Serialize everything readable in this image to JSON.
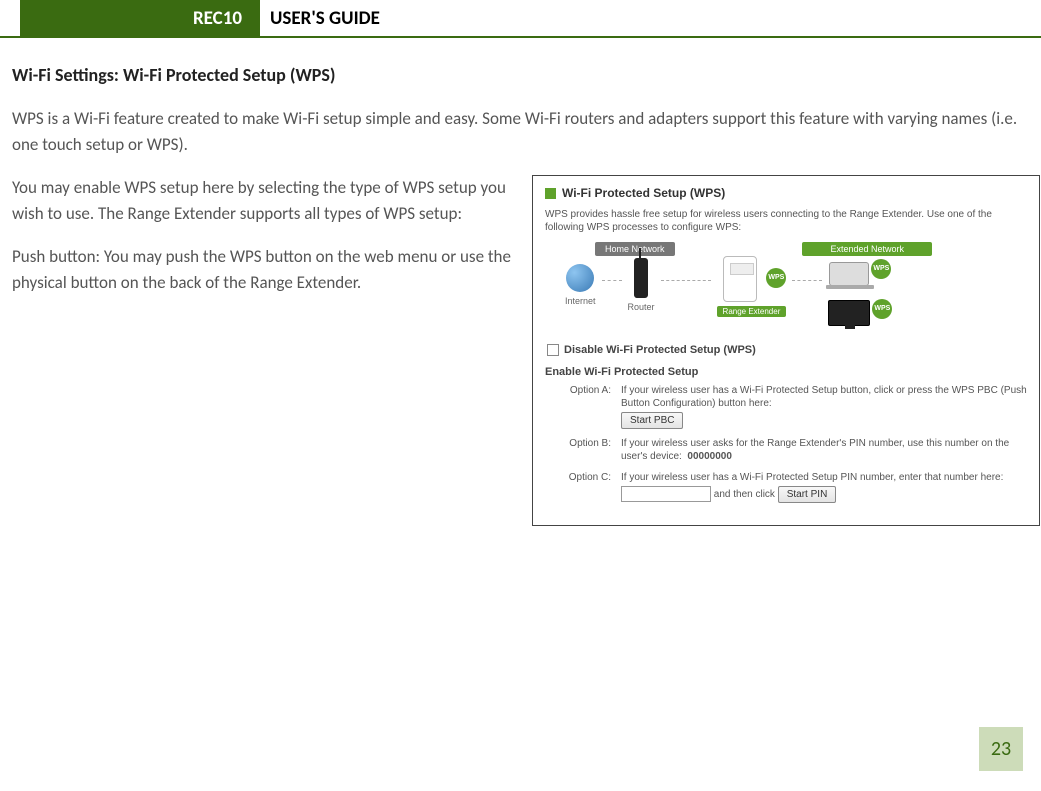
{
  "header": {
    "product": "REC10",
    "title": "USER'S GUIDE"
  },
  "section_title": "Wi-Fi Settings: Wi-Fi Protected Setup (WPS)",
  "para1": "WPS is a Wi-Fi feature created to make Wi-Fi setup simple and easy.  Some Wi-Fi routers and adapters support this feature with varying names (i.e. one touch setup or WPS).",
  "para2": "You may enable WPS setup here by selecting the type of WPS setup you wish to use.  The Range Extender supports all types of WPS setup:",
  "para3": "Push button: You may push the WPS button on the web menu or use the physical button on the back of the Range Extender.",
  "screenshot": {
    "title": "Wi-Fi Protected Setup (WPS)",
    "sub": "WPS provides hassle free setup for wireless users connecting to the Range Extender. Use one of the following WPS processes to configure WPS:",
    "home_network": "Home Network",
    "extended_network": "Extended Network",
    "internet": "Internet",
    "router": "Router",
    "range_extender": "Range Extender",
    "wps": "WPS",
    "disable_label": "Disable Wi-Fi Protected Setup (WPS)",
    "enable_title": "Enable Wi-Fi Protected Setup",
    "optionA": {
      "label": "Option A:",
      "text": "If your wireless user has a Wi-Fi Protected Setup button, click or press the WPS PBC (Push Button Configuration) button here:",
      "button": "Start PBC"
    },
    "optionB": {
      "label": "Option B:",
      "text": "If your wireless user asks for the Range Extender's PIN number, use this number on the user's device:",
      "pin": "00000000"
    },
    "optionC": {
      "label": "Option C:",
      "text": "If your wireless user has a Wi-Fi Protected Setup PIN number, enter that number here:",
      "and_then": "and then click",
      "button": "Start PIN"
    }
  },
  "page_number": "23"
}
